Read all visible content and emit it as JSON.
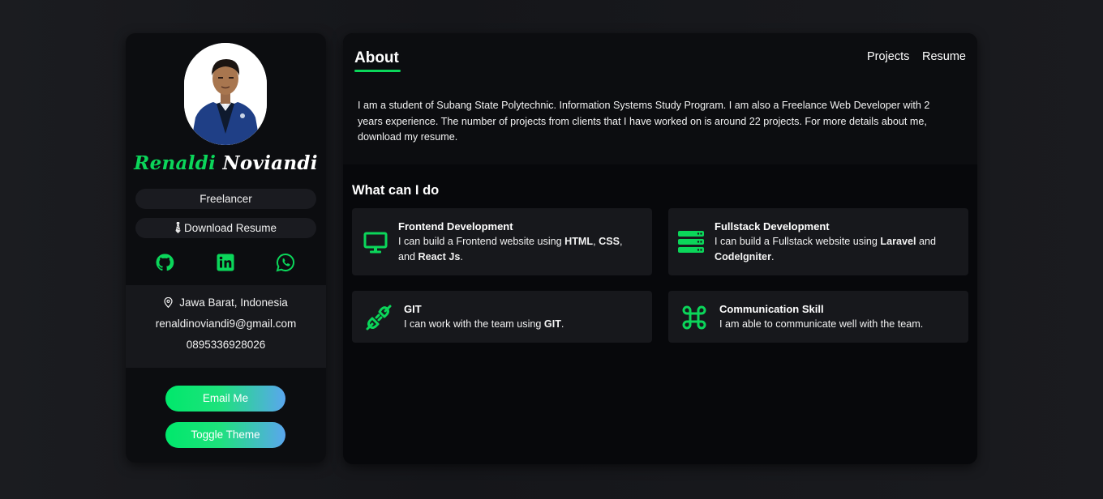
{
  "profile": {
    "first_name": "Renaldi",
    "last_name": "Noviandi",
    "role": "Freelancer",
    "download_label": "Download Resume",
    "download_icon": "necktie-icon",
    "socials": [
      {
        "icon": "github-icon"
      },
      {
        "icon": "linkedin-icon"
      },
      {
        "icon": "whatsapp-icon"
      }
    ],
    "location": "Jawa Barat, Indonesia",
    "email": "renaldinoviandi9@gmail.com",
    "phone": "0895336928026",
    "email_button": "Email Me",
    "theme_button": "Toggle Theme"
  },
  "nav": {
    "title": "About",
    "links": [
      "Projects",
      "Resume"
    ]
  },
  "about": {
    "text": "I am a student of Subang State Polytechnic. Information Systems Study Program. I am also a Freelance Web Developer with 2 years experience. The number of projects from clients that I have worked on is around 22 projects. For more details about me, download my resume."
  },
  "skills": {
    "heading": "What can I do",
    "items": [
      {
        "icon": "monitor-icon",
        "title": "Frontend Development",
        "desc_parts": [
          "I can build a Frontend website using ",
          "HTML",
          ", ",
          "CSS",
          ",",
          " and ",
          "React Js",
          "."
        ]
      },
      {
        "icon": "server-icon",
        "title": "Fullstack Development",
        "desc_parts": [
          "I can build a Fullstack website using ",
          "Laravel",
          " and",
          "CodeIgniter",
          "."
        ]
      },
      {
        "icon": "plug-icon",
        "title": "GIT",
        "desc_parts": [
          "I can work with the team using ",
          "GIT",
          "."
        ]
      },
      {
        "icon": "command-icon",
        "title": "Communication Skill",
        "desc_parts": [
          "I am able to communicate well with the team."
        ]
      }
    ]
  },
  "colors": {
    "accent": "#0bd65a",
    "sidebar_bg": "#0c0d10",
    "card_bg": "#17181c",
    "gradient_start": "#00e86b",
    "gradient_end": "#5aa6ee"
  }
}
